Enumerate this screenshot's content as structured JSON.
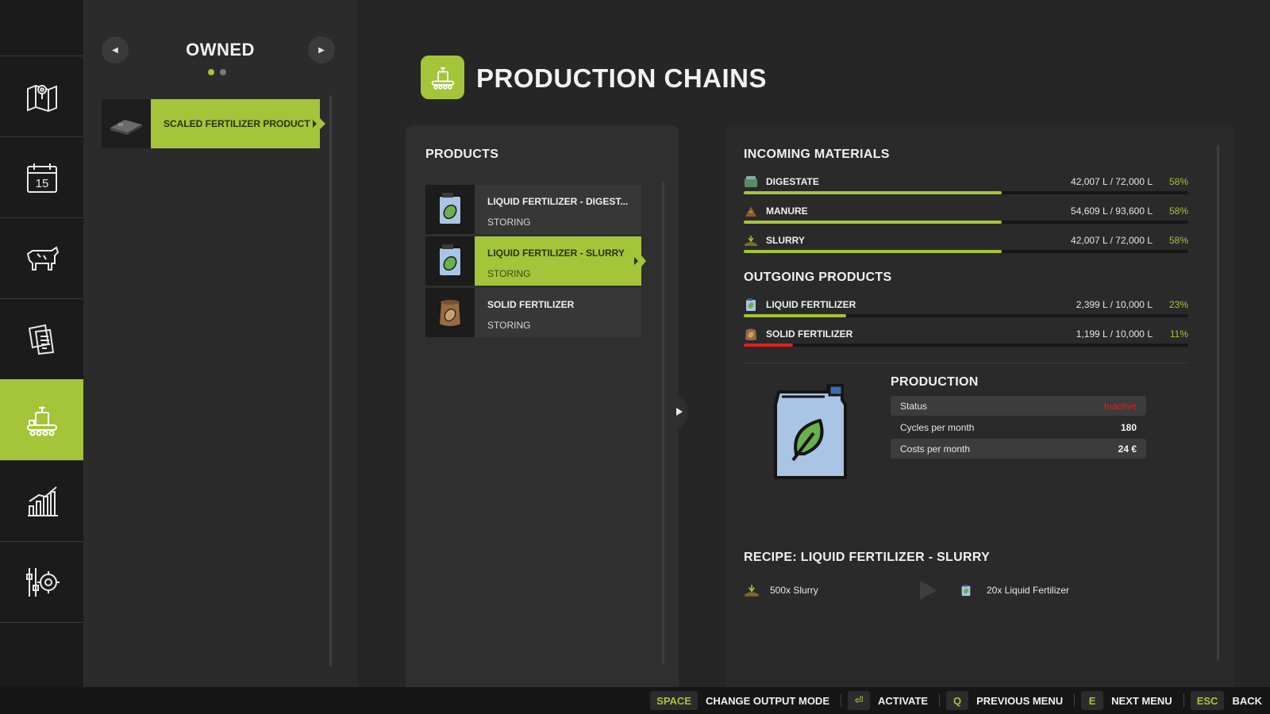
{
  "sidebar": {
    "items": [
      {
        "icon": "map-icon"
      },
      {
        "icon": "calendar-icon",
        "day": "15"
      },
      {
        "icon": "animals-icon"
      },
      {
        "icon": "contracts-icon"
      },
      {
        "icon": "production-icon"
      },
      {
        "icon": "statistics-icon"
      },
      {
        "icon": "settings-icon"
      }
    ],
    "active_index": 4
  },
  "owned": {
    "title": "OWNED",
    "pages": 2,
    "current_page": 1,
    "items": [
      {
        "label": "SCALED FERTILIZER PRODUCT"
      }
    ]
  },
  "header": {
    "title": "PRODUCTION CHAINS",
    "icon": "production-icon"
  },
  "products": {
    "heading": "PRODUCTS",
    "items": [
      {
        "name": "LIQUID FERTILIZER - DIGEST...",
        "status": "STORING",
        "icon": "liquid-fertilizer-icon"
      },
      {
        "name": "LIQUID FERTILIZER - SLURRY",
        "status": "STORING",
        "icon": "liquid-fertilizer-icon"
      },
      {
        "name": "SOLID FERTILIZER",
        "status": "STORING",
        "icon": "solid-fertilizer-icon"
      }
    ],
    "selected_index": 1
  },
  "incoming": {
    "heading": "INCOMING MATERIALS",
    "items": [
      {
        "name": "DIGESTATE",
        "amount": "42,007 L / 72,000 L",
        "percent": "58%",
        "fill": 0.58,
        "icon": "digestate-icon"
      },
      {
        "name": "MANURE",
        "amount": "54,609 L / 93,600 L",
        "percent": "58%",
        "fill": 0.58,
        "icon": "manure-icon"
      },
      {
        "name": "SLURRY",
        "amount": "42,007 L / 72,000 L",
        "percent": "58%",
        "fill": 0.58,
        "icon": "slurry-icon"
      }
    ]
  },
  "outgoing": {
    "heading": "OUTGOING PRODUCTS",
    "items": [
      {
        "name": "LIQUID FERTILIZER",
        "amount": "2,399 L / 10,000 L",
        "percent": "23%",
        "fill": 0.23,
        "icon": "liquid-fertilizer-icon"
      },
      {
        "name": "SOLID FERTILIZER",
        "amount": "1,199 L / 10,000 L",
        "percent": "11%",
        "fill": 0.11,
        "icon": "solid-fertilizer-icon"
      }
    ]
  },
  "production": {
    "heading": "PRODUCTION",
    "rows": [
      {
        "label": "Status",
        "value": "Inactive"
      },
      {
        "label": "Cycles per month",
        "value": "180"
      },
      {
        "label": "Costs per month",
        "value": "24 €"
      }
    ]
  },
  "recipe": {
    "heading": "RECIPE: LIQUID FERTILIZER - SLURRY",
    "input": "500x Slurry",
    "output": "20x Liquid Fertilizer"
  },
  "footer": {
    "hints": [
      {
        "key": "SPACE",
        "label": "CHANGE OUTPUT MODE"
      },
      {
        "key": "⏎",
        "label": "ACTIVATE"
      },
      {
        "key": "Q",
        "label": "PREVIOUS MENU"
      },
      {
        "key": "E",
        "label": "NEXT MENU"
      },
      {
        "key": "ESC",
        "label": "BACK"
      }
    ]
  },
  "colors": {
    "accent": "#a4c43a",
    "warning": "#e01e1e",
    "background": "#262626",
    "rail": "#1b1b1b"
  }
}
